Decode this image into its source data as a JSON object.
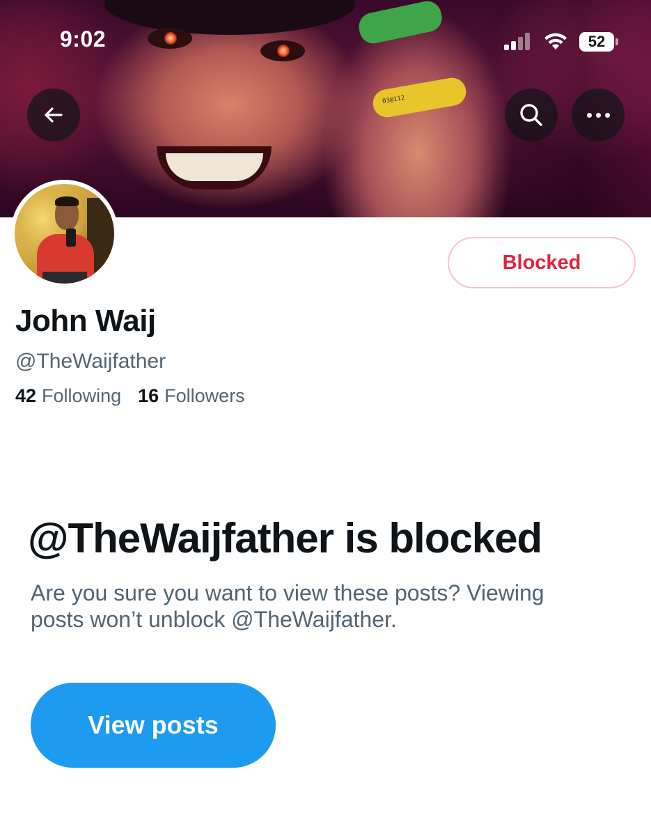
{
  "status_bar": {
    "time": "9:02",
    "battery_level": "52",
    "icons": [
      "cellular-signal-icon",
      "wifi-icon",
      "battery-icon"
    ]
  },
  "header": {
    "back_icon": "arrow-left-icon",
    "search_icon": "search-icon",
    "more_icon": "more-horizontal-icon"
  },
  "profile": {
    "display_name": "John Waij",
    "handle": "@TheWaijfather",
    "following_count": "42",
    "following_label": "Following",
    "followers_count": "16",
    "followers_label": "Followers",
    "blocked_button_label": "Blocked"
  },
  "blocked_notice": {
    "title": "@TheWaijfather is blocked",
    "description": "Are you sure you want to view these posts? Viewing posts won’t unblock @TheWaijfather.",
    "view_posts_label": "View posts"
  },
  "banner": {
    "wristband_text": "03@112"
  },
  "colors": {
    "blocked_red": "#e0243b",
    "blocked_border": "#f7c4ca",
    "primary_blue": "#1d9bf0",
    "text_primary": "#0f1419",
    "text_secondary": "#536471"
  }
}
